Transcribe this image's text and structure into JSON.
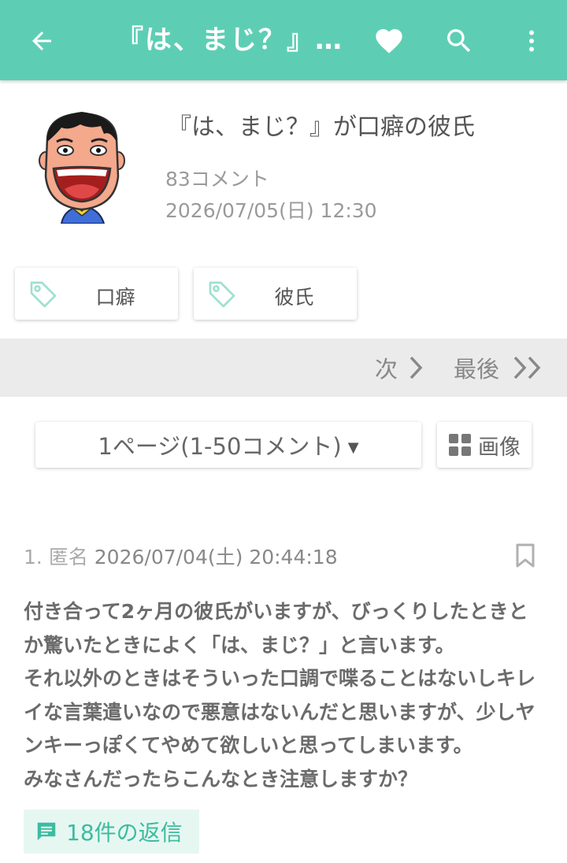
{
  "topbar": {
    "title": "『は、まじ？』...",
    "back_icon": "arrow-left-icon",
    "favorite_icon": "heart-icon",
    "search_icon": "search-icon",
    "menu_icon": "more-vertical-icon",
    "color": "#5dceb4"
  },
  "post": {
    "title": "『は、まじ？』が口癖の彼氏",
    "comment_count": "83コメント",
    "date": "2026/07/05(日) 12:30"
  },
  "tags": [
    {
      "label": "口癖",
      "icon": "tag-icon"
    },
    {
      "label": "彼氏",
      "icon": "tag-icon"
    }
  ],
  "pager": {
    "next_label": "次",
    "last_label": "最後",
    "page_select": "1ページ(1-50コメント)",
    "image_button": "画像"
  },
  "comment": {
    "number": "1.",
    "author": "匿名",
    "date": "2026/07/04(土) 20:44:18",
    "body": "付き合って2ヶ月の彼氏がいますが、びっくりしたときとか驚いたときによく「は、まじ？」と言います。\nそれ以外のときはそういった口調で喋ることはないしキレイな言葉遣いなので悪意はないんだと思いますが、少しヤンキーっぽくてやめて欲しいと思ってしまいます。\nみなさんだったらこんなとき注意しますか？",
    "replies_label": "18件の返信"
  }
}
